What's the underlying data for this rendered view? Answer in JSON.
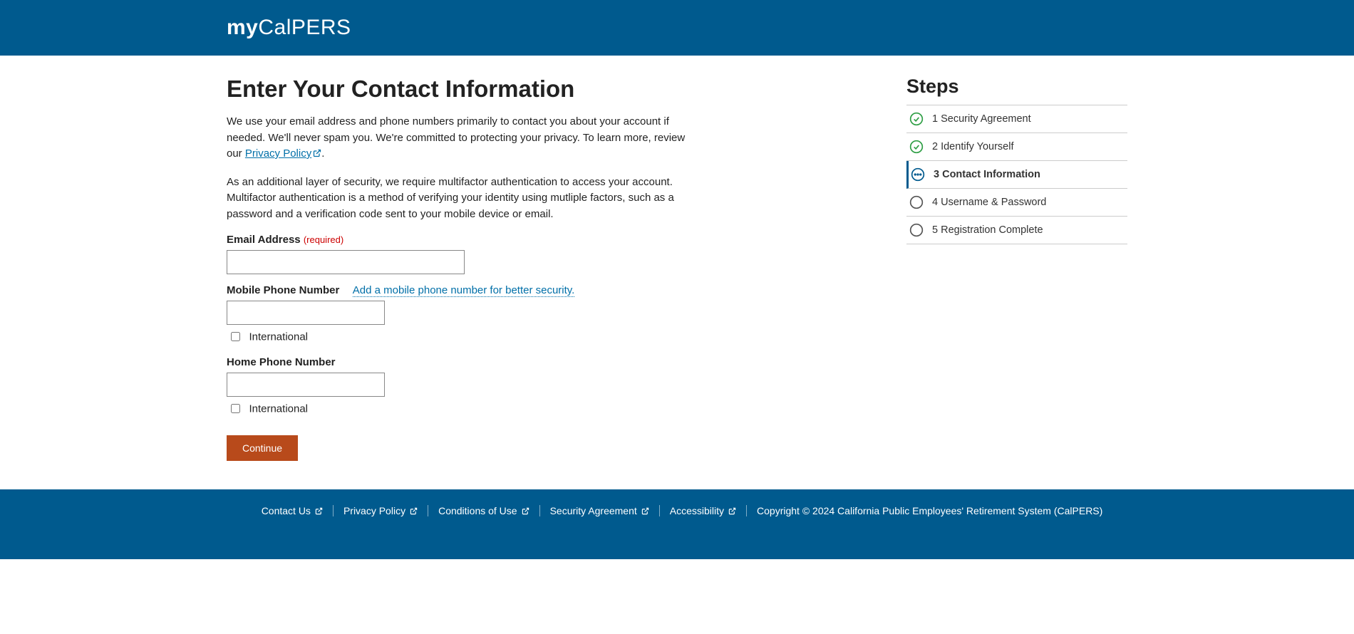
{
  "logo": {
    "prefix": "my",
    "suffix": "CalPERS"
  },
  "page": {
    "title": "Enter Your Contact Information",
    "intro_part1": "We use your email address and phone numbers primarily to contact you about your account if needed. We'll never spam you. We're committed to protecting your privacy. To learn more, review our ",
    "privacy_link": "Privacy Policy",
    "intro_part1_end": ".",
    "intro_part2": "As an additional layer of security, we require multifactor authentication to access your account. Multifactor authentication is a method of verifying your identity using mutliple factors, such as a password and a verification code sent to your mobile device or email."
  },
  "form": {
    "email_label": "Email Address",
    "required": "(required)",
    "mobile_label": "Mobile Phone Number",
    "mobile_hint": "Add a mobile phone number for better security.",
    "international": "International",
    "home_label": "Home Phone Number",
    "continue": "Continue"
  },
  "steps": {
    "heading": "Steps",
    "items": [
      {
        "label": "1 Security Agreement",
        "status": "done"
      },
      {
        "label": "2 Identify Yourself",
        "status": "done"
      },
      {
        "label": "3 Contact Information",
        "status": "current"
      },
      {
        "label": "4 Username & Password",
        "status": "pending"
      },
      {
        "label": "5 Registration Complete",
        "status": "pending"
      }
    ]
  },
  "footer": {
    "links": [
      "Contact Us",
      "Privacy Policy",
      "Conditions of Use",
      "Security Agreement",
      "Accessibility"
    ],
    "copyright": "Copyright © 2024 California Public Employees' Retirement System (CalPERS)"
  }
}
